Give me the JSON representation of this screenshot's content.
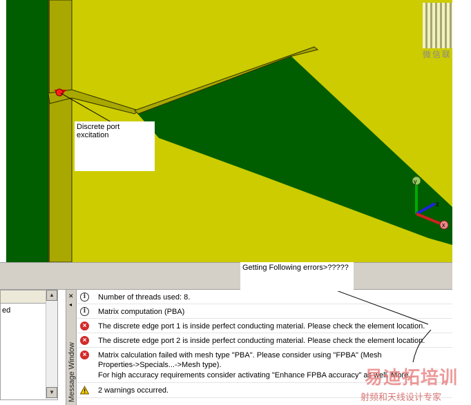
{
  "viewport": {
    "annotation_port": "Discrete port excitation",
    "annotation_errors": "Getting Following errors>?????",
    "axes": {
      "y": "y",
      "z": "z",
      "x": "x"
    },
    "watermark": {
      "top_text": "微信联系",
      "bottom_text": "射频和天线设计专家",
      "logo_text": "易迪拓培训"
    }
  },
  "left_panel": {
    "row_text": "ed"
  },
  "message_window": {
    "title": "Message Window",
    "messages": [
      {
        "type": "info",
        "text": "Number of threads used: 8."
      },
      {
        "type": "info",
        "text": "Matrix computation (PBA)"
      },
      {
        "type": "error",
        "text": "The discrete edge port 1 is inside perfect conducting material. Please check the element location."
      },
      {
        "type": "error",
        "text": "The discrete edge port 2 is inside perfect conducting material. Please check the element location."
      },
      {
        "type": "error",
        "text": "Matrix calculation failed with mesh type \"PBA\". Please consider using \"FPBA\" (Mesh Properties->Specials...->Mesh type)."
      },
      {
        "type": "none",
        "text": "For high accuracy requirements consider activating \"Enhance FPBA accuracy\" as well. More..."
      },
      {
        "type": "warning",
        "text": "2 warnings occurred."
      }
    ]
  },
  "colors": {
    "background_yellow": "#cccc00",
    "metal_green": "#005e00",
    "trace_olive": "#a8a800",
    "error_red": "#d22a2a"
  }
}
